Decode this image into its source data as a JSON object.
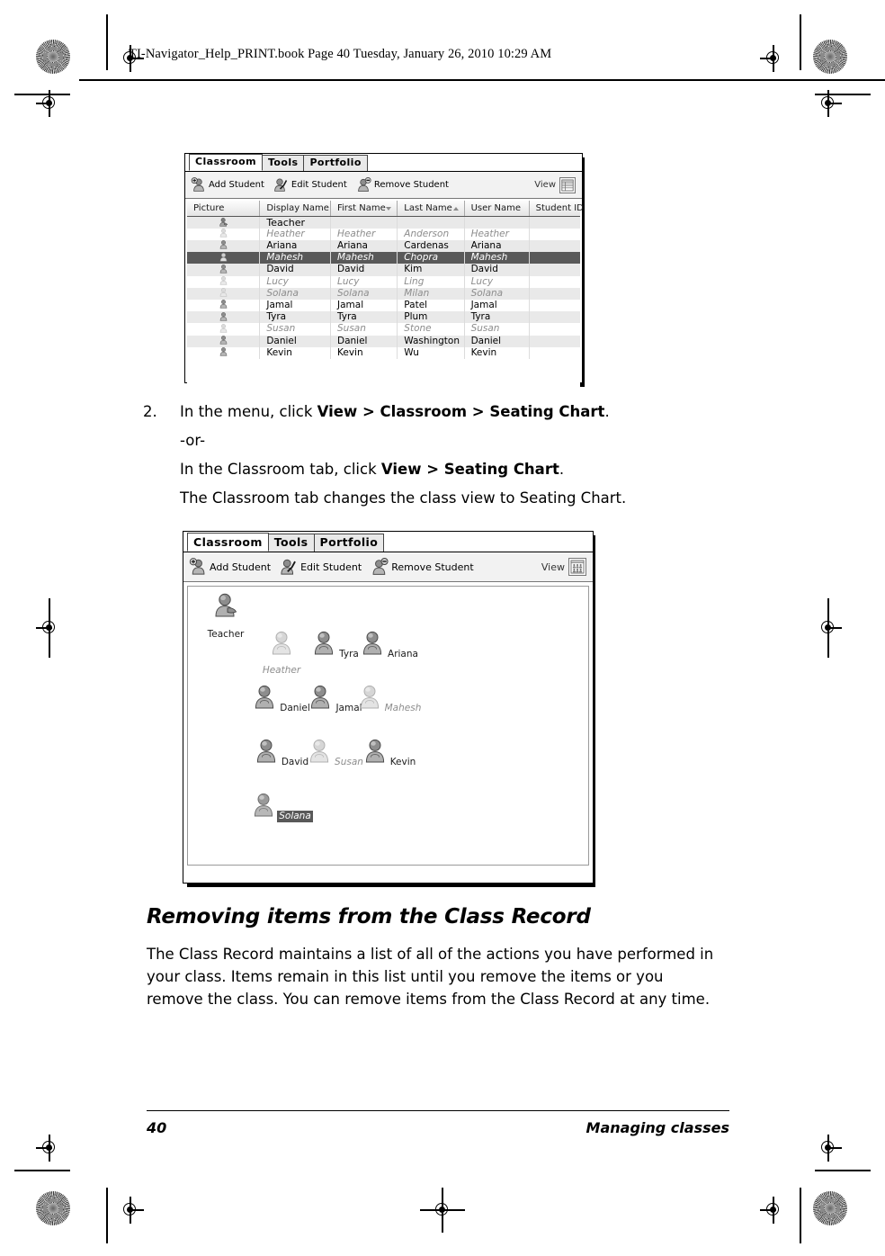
{
  "page": {
    "book_header": "TI-Navigator_Help_PRINT.book  Page 40  Tuesday, January 26, 2010  10:29 AM",
    "footer_page_number": "40",
    "footer_section": "Managing classes"
  },
  "screenshot_list_view": {
    "tabs": [
      {
        "label": "Classroom",
        "active": true
      },
      {
        "label": "Tools",
        "active": false
      },
      {
        "label": "Portfolio",
        "active": false
      }
    ],
    "toolbar": {
      "buttons": [
        {
          "label": "Add Student",
          "icon": "add-student-icon"
        },
        {
          "label": "Edit Student",
          "icon": "edit-student-icon"
        },
        {
          "label": "Remove Student",
          "icon": "remove-student-icon"
        }
      ],
      "view_label": "View",
      "view_icon": "list-view-icon"
    },
    "table": {
      "columns": [
        {
          "label": "Picture",
          "sort": "none"
        },
        {
          "label": "Display Name",
          "sort": "none"
        },
        {
          "label": "First Name",
          "sort": "desc"
        },
        {
          "label": "Last Name",
          "sort": "asc"
        },
        {
          "label": "User Name",
          "sort": "none"
        },
        {
          "label": "Student ID",
          "sort": "none"
        }
      ],
      "rows": [
        {
          "display_name": "Teacher",
          "first_name": "",
          "last_name": "",
          "user_name": "",
          "student_id": "",
          "state": "teacher"
        },
        {
          "display_name": "Heather",
          "first_name": "Heather",
          "last_name": "Anderson",
          "user_name": "Heather",
          "student_id": "",
          "state": "logged-out"
        },
        {
          "display_name": "Ariana",
          "first_name": "Ariana",
          "last_name": "Cardenas",
          "user_name": "Ariana",
          "student_id": "",
          "state": "logged-in"
        },
        {
          "display_name": "Mahesh",
          "first_name": "Mahesh",
          "last_name": "Chopra",
          "user_name": "Mahesh",
          "student_id": "",
          "state": "selected"
        },
        {
          "display_name": "David",
          "first_name": "David",
          "last_name": "Kim",
          "user_name": "David",
          "student_id": "",
          "state": "logged-in"
        },
        {
          "display_name": "Lucy",
          "first_name": "Lucy",
          "last_name": "Ling",
          "user_name": "Lucy",
          "student_id": "",
          "state": "logged-out"
        },
        {
          "display_name": "Solana",
          "first_name": "Solana",
          "last_name": "Milan",
          "user_name": "Solana",
          "student_id": "",
          "state": "logged-out"
        },
        {
          "display_name": "Jamal",
          "first_name": "Jamal",
          "last_name": "Patel",
          "user_name": "Jamal",
          "student_id": "",
          "state": "logged-in"
        },
        {
          "display_name": "Tyra",
          "first_name": "Tyra",
          "last_name": "Plum",
          "user_name": "Tyra",
          "student_id": "",
          "state": "logged-in"
        },
        {
          "display_name": "Susan",
          "first_name": "Susan",
          "last_name": "Stone",
          "user_name": "Susan",
          "student_id": "",
          "state": "logged-out"
        },
        {
          "display_name": "Daniel",
          "first_name": "Daniel",
          "last_name": "Washington",
          "user_name": "Daniel",
          "student_id": "",
          "state": "logged-in"
        },
        {
          "display_name": "Kevin",
          "first_name": "Kevin",
          "last_name": "Wu",
          "user_name": "Kevin",
          "student_id": "",
          "state": "logged-in"
        }
      ]
    }
  },
  "steps": {
    "step2_number": "2.",
    "step2_line1_pre": "In the menu, click ",
    "step2_line1_bold": "View > Classroom > Seating Chart",
    "step2_line1_post": ".",
    "or_text": "-or-",
    "step2_line2_pre": "In the Classroom tab, click ",
    "step2_line2_bold": "View > Seating Chart",
    "step2_line2_post": ".",
    "step2_result": "The Classroom tab changes the class view to Seating Chart."
  },
  "screenshot_seating_view": {
    "tabs": [
      {
        "label": "Classroom",
        "active": true
      },
      {
        "label": "Tools",
        "active": false
      },
      {
        "label": "Portfolio",
        "active": false
      }
    ],
    "toolbar": {
      "buttons": [
        {
          "label": "Add Student",
          "icon": "add-student-icon"
        },
        {
          "label": "Edit Student",
          "icon": "edit-student-icon"
        },
        {
          "label": "Remove Student",
          "icon": "remove-student-icon"
        }
      ],
      "view_label": "View",
      "view_icon": "seating-chart-view-icon"
    },
    "teacher": {
      "label": "Teacher",
      "state": "teacher"
    },
    "seats": [
      {
        "label": "Heather",
        "state": "logged-out",
        "row": 0,
        "col": 0
      },
      {
        "label": "Tyra",
        "state": "logged-in",
        "row": 0,
        "col": 1
      },
      {
        "label": "Ariana",
        "state": "logged-in",
        "row": 0,
        "col": 2
      },
      {
        "label": "Daniel",
        "state": "logged-in",
        "row": 1,
        "col": 0
      },
      {
        "label": "Jamal",
        "state": "logged-in",
        "row": 1,
        "col": 1
      },
      {
        "label": "Mahesh",
        "state": "logged-out",
        "row": 1,
        "col": 2
      },
      {
        "label": "David",
        "state": "logged-in",
        "row": 2,
        "col": 0
      },
      {
        "label": "Susan",
        "state": "logged-out",
        "row": 2,
        "col": 1
      },
      {
        "label": "Kevin",
        "state": "logged-in",
        "row": 2,
        "col": 2
      },
      {
        "label": "Solana",
        "state": "selected",
        "row": 3,
        "col": 0
      }
    ]
  },
  "section": {
    "heading": "Removing items from the Class Record",
    "body": "The Class Record maintains a list of all of the actions you have performed in your class. Items remain in this list until you remove the items or you remove the class. You can remove items from the Class Record at any time."
  },
  "colors": {
    "selection": "#595959",
    "row_alt": "#e9e9e9",
    "inactive_text": "#8d8d8d",
    "toolbar_bg": "#f2f2f2"
  }
}
